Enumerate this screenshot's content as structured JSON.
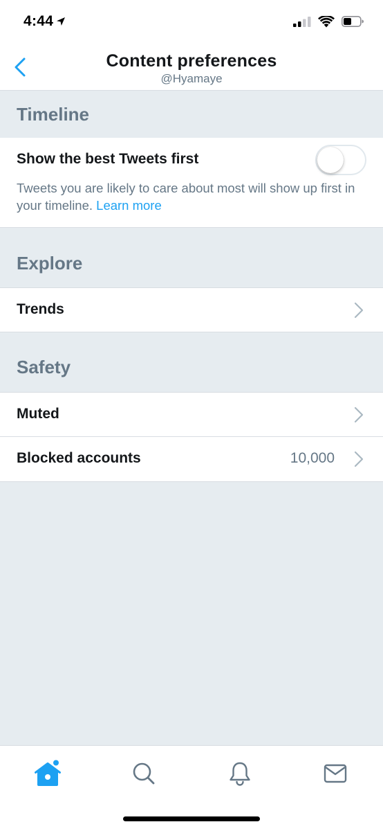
{
  "status_bar": {
    "time": "4:44",
    "icons": [
      "location-arrow-icon",
      "cellular-signal-icon",
      "wifi-icon",
      "battery-icon"
    ]
  },
  "header": {
    "title": "Content preferences",
    "subtitle": "@Hyamaye",
    "back_icon": "chevron-left-icon"
  },
  "sections": {
    "timeline": {
      "title": "Timeline",
      "best_tweets": {
        "label": "Show the best Tweets first",
        "enabled": false,
        "description": "Tweets you are likely to care about most will show up first in your timeline.",
        "link": "Learn more"
      }
    },
    "explore": {
      "title": "Explore",
      "trends_label": "Trends"
    },
    "safety": {
      "title": "Safety",
      "muted_label": "Muted",
      "blocked_label": "Blocked accounts",
      "blocked_count": "10,000"
    }
  },
  "tab_bar": {
    "items": [
      "home-icon",
      "search-icon",
      "notifications-bell-icon",
      "messages-envelope-icon"
    ],
    "active": "home-icon",
    "unread_dot": true
  },
  "colors": {
    "accent": "#1da1f2",
    "background": "#e6ecf0",
    "secondary_text": "#657786",
    "primary_text": "#14171a"
  }
}
